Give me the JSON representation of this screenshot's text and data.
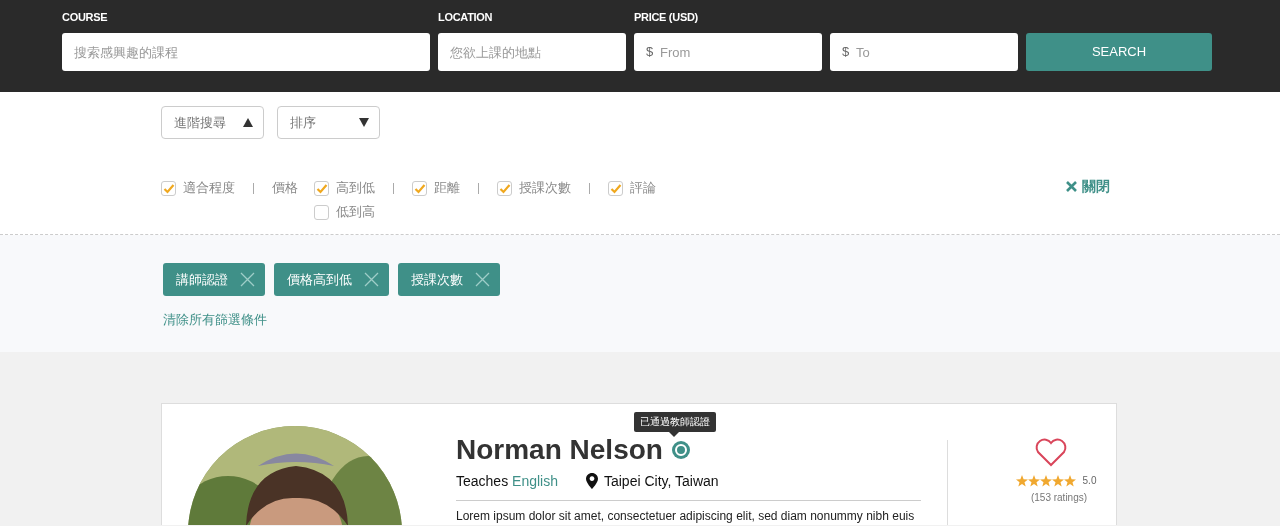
{
  "search_bar": {
    "course": {
      "label": "COURSE",
      "placeholder": "搜索感興趣的課程"
    },
    "location": {
      "label": "LOCATION",
      "placeholder": "您欲上課的地點"
    },
    "price": {
      "label": "PRICE (USD)",
      "fields": [
        {
          "prefix": "$",
          "placeholder": "From"
        },
        {
          "prefix": "$",
          "placeholder": "To"
        }
      ]
    },
    "button": "SEARCH"
  },
  "dropdowns": [
    {
      "label": "進階搜尋",
      "expanded": true
    },
    {
      "label": "排序",
      "expanded": false
    }
  ],
  "sort_groups": [
    {
      "options": [
        {
          "label": "適合程度",
          "checked": true
        }
      ]
    },
    {
      "label": "價格",
      "options": [
        {
          "label": "高到低",
          "checked": true
        },
        {
          "label": "低到高",
          "checked": false
        }
      ]
    },
    {
      "options": [
        {
          "label": "距離",
          "checked": true
        }
      ]
    },
    {
      "options": [
        {
          "label": "授課次數",
          "checked": true
        }
      ]
    },
    {
      "options": [
        {
          "label": "評論",
          "checked": true
        }
      ]
    }
  ],
  "close_button": "關閉",
  "active_filters": [
    "講師認證",
    "價格高到低",
    "授課次數"
  ],
  "clear_filters": "清除所有篩選條件",
  "teacher": {
    "name": "Norman Nelson",
    "verified": true,
    "verified_tooltip": "已通過教師認證",
    "teaches_label": "Teaches",
    "subject": "English",
    "location": "Taipei City, Taiwan",
    "description": "Lorem ipsum dolor sit amet, consectetuer adipiscing elit, sed diam nonummy nibh euis",
    "favorited": false,
    "stars": 5,
    "rating": "5.0",
    "ratings_count": "(153 ratings)"
  }
}
